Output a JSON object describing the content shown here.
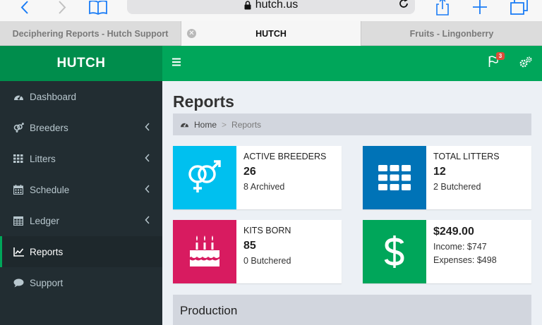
{
  "browser": {
    "url": "hutch.us",
    "tabs": [
      {
        "label": "Deciphering Reports - Hutch Support",
        "active": false
      },
      {
        "label": "HUTCH",
        "active": true
      },
      {
        "label": "Fruits - Lingonberry",
        "active": false
      }
    ]
  },
  "app": {
    "brand": "HUTCH",
    "accent_color": "#00a65a",
    "brand_color": "#008d4c",
    "sidebar_bg": "#222d32"
  },
  "sidebar": {
    "items": [
      {
        "label": "Dashboard",
        "icon": "dashboard-icon",
        "has_submenu": false,
        "active": false
      },
      {
        "label": "Breeders",
        "icon": "breeders-icon",
        "has_submenu": true,
        "active": false
      },
      {
        "label": "Litters",
        "icon": "grid-icon",
        "has_submenu": true,
        "active": false
      },
      {
        "label": "Schedule",
        "icon": "calendar-icon",
        "has_submenu": true,
        "active": false
      },
      {
        "label": "Ledger",
        "icon": "table-icon",
        "has_submenu": true,
        "active": false
      },
      {
        "label": "Reports",
        "icon": "line-chart-icon",
        "has_submenu": false,
        "active": true
      },
      {
        "label": "Support",
        "icon": "comment-icon",
        "has_submenu": false,
        "active": false
      }
    ]
  },
  "header": {
    "notification_count": "3"
  },
  "page": {
    "title": "Reports",
    "breadcrumb": {
      "home": "Home",
      "current": "Reports"
    }
  },
  "stats": {
    "active_breeders": {
      "label": "Active Breeders",
      "value": "26",
      "sub": "8 Archived",
      "color": "#00c0ef"
    },
    "total_litters": {
      "label": "Total Litters",
      "value": "12",
      "sub": "2 Butchered",
      "color": "#0073b7"
    },
    "kits_born": {
      "label": "Kits Born",
      "value": "85",
      "sub": "0 Butchered",
      "color": "#d81b60"
    },
    "ledger": {
      "value": "$249.00",
      "income": "Income: $747",
      "expenses": "Expenses: $498",
      "color": "#00a65a"
    }
  },
  "section": {
    "title": "Production"
  }
}
